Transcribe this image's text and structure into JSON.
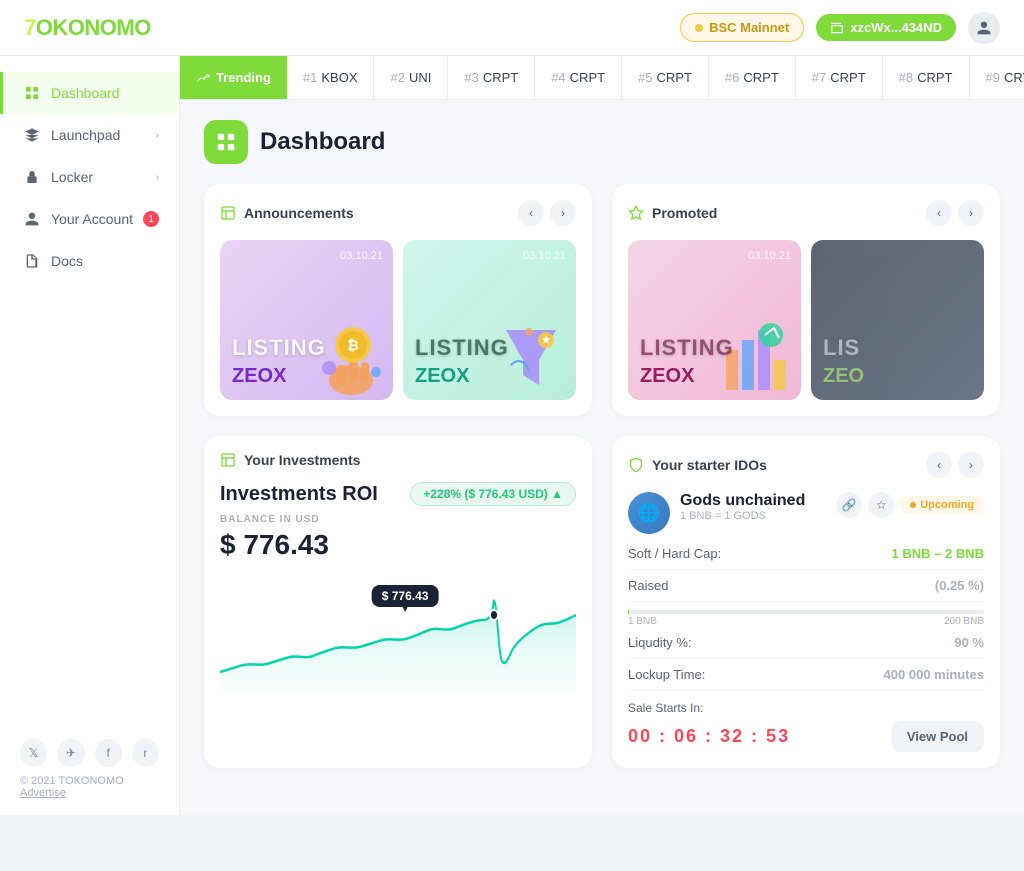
{
  "topnav": {
    "logo": "7OKONOMO",
    "network_label": "BSC Mainnet",
    "wallet_label": "xzcWx...434ND"
  },
  "ticker": {
    "trending_label": "Trending",
    "items": [
      {
        "rank": "#1",
        "symbol": "KBOX"
      },
      {
        "rank": "#2",
        "symbol": "UNI"
      },
      {
        "rank": "#3",
        "symbol": "CRPT"
      },
      {
        "rank": "#4",
        "symbol": "CRPT"
      },
      {
        "rank": "#5",
        "symbol": "CRPT"
      },
      {
        "rank": "#6",
        "symbol": "CRPT"
      },
      {
        "rank": "#7",
        "symbol": "CRPT"
      },
      {
        "rank": "#8",
        "symbol": "CRPT"
      },
      {
        "rank": "#9",
        "symbol": "CRYP"
      }
    ]
  },
  "sidebar": {
    "items": [
      {
        "label": "Dashboard",
        "active": true
      },
      {
        "label": "Launchpad",
        "active": false,
        "arrow": true
      },
      {
        "label": "Locker",
        "active": false,
        "arrow": true
      },
      {
        "label": "Your Account",
        "active": false,
        "badge": "1"
      },
      {
        "label": "Docs",
        "active": false
      }
    ],
    "footer": {
      "copyright": "© 2021 TOKONOMO",
      "advertise": "Advertise"
    }
  },
  "dashboard": {
    "title": "Dashboard",
    "announcements": {
      "section_label": "Announcements",
      "cards": [
        {
          "type": "purple",
          "listing": "LISTING",
          "date": "03.10.21",
          "brand": "ZEOX"
        },
        {
          "type": "mint",
          "listing": "LISTING",
          "date": "03.10.21",
          "brand": "ZEOX"
        }
      ]
    },
    "promoted": {
      "section_label": "Promoted",
      "cards": [
        {
          "type": "pink",
          "listing": "LISTING",
          "date": "03.10.21",
          "brand": "ZEOX"
        },
        {
          "type": "dark",
          "listing": "LIS",
          "date": "",
          "brand": "ZEO"
        }
      ]
    },
    "investments": {
      "section_label": "Your Investments",
      "title": "Investments ROI",
      "badge": "+228% ($ 776.43 USD) ▲",
      "balance_label": "BALANCE IN USD",
      "balance_value": "$ 776.43",
      "tooltip_value": "$ 776.43"
    },
    "ido": {
      "section_label": "Your starter IDOs",
      "project_name": "Gods unchained",
      "project_sub": "1 BNB = 1 GODS",
      "project_logo": "🌐",
      "upcoming_label": "Upcoming",
      "details": [
        {
          "label": "Soft / Hard Cap:",
          "value": "1 BNB – 2 BNB"
        },
        {
          "label": "Raised",
          "value": "(0.25 %)"
        },
        {
          "label": "Liqudity %:",
          "value": "90 %"
        },
        {
          "label": "Lockup Time:",
          "value": "400 000 minutes"
        }
      ],
      "progress_min": "1 BNB",
      "progress_max": "200 BNB",
      "countdown_label": "Sale Starts In:",
      "countdown": "00 : 06 : 32 : 53",
      "view_pool_label": "View Pool"
    }
  }
}
